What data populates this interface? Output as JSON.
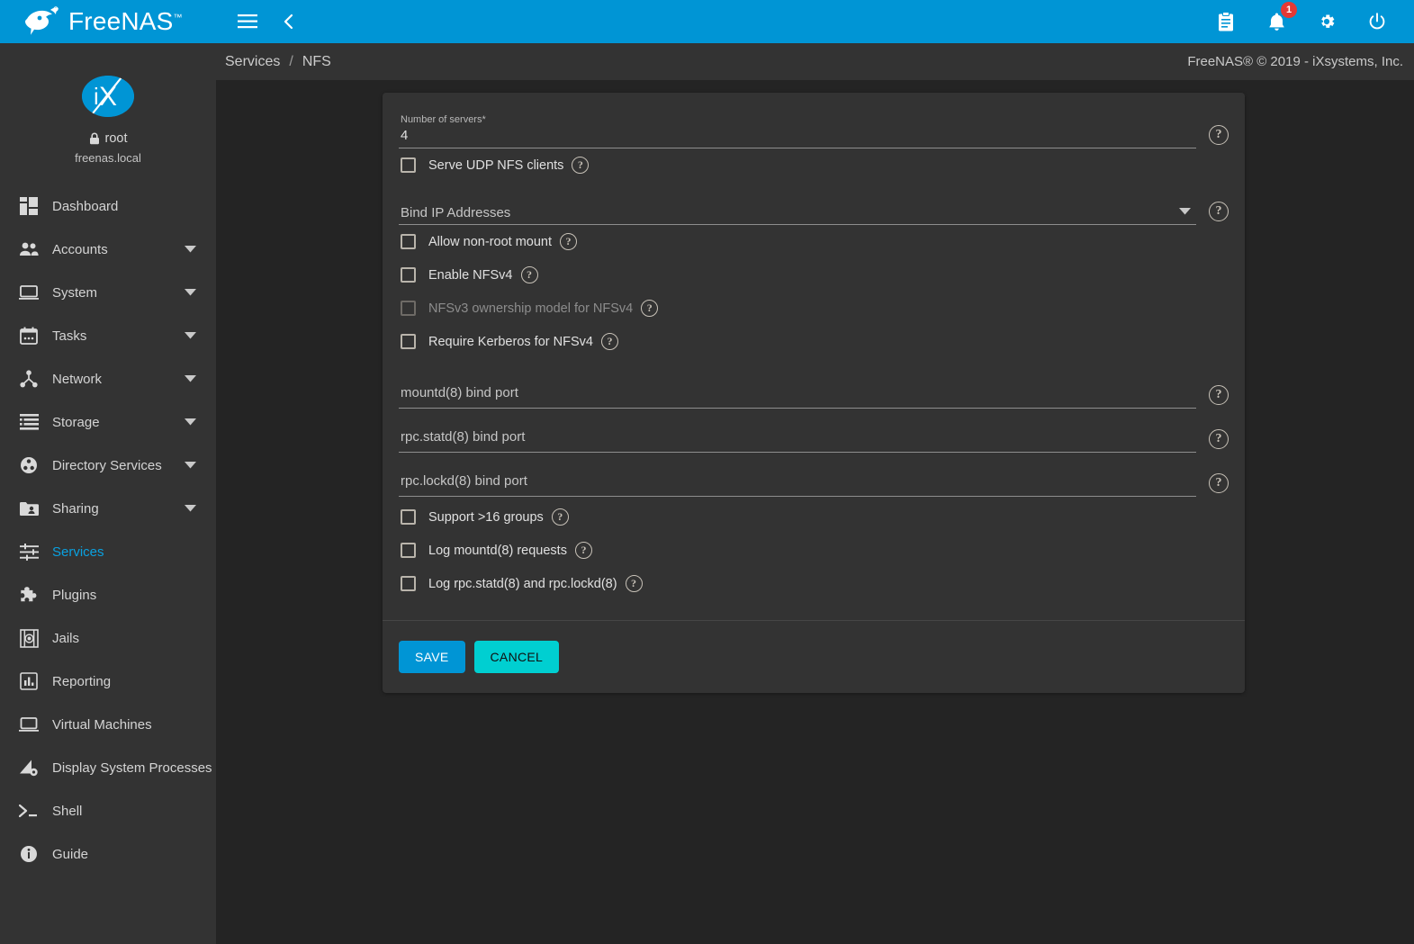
{
  "topbar": {
    "brand": "FreeNAS",
    "brand_tm": "™",
    "menu_icon": "hamburger-icon",
    "back_icon": "chevron-left-icon",
    "right_icons": [
      {
        "name": "clipboard-icon",
        "label": "Tasks"
      },
      {
        "name": "notifications-bell-icon",
        "label": "Alerts",
        "badge": "1"
      },
      {
        "name": "gear-icon",
        "label": "Settings"
      },
      {
        "name": "power-icon",
        "label": "Power"
      }
    ],
    "accent_color": "#0095d5"
  },
  "sidebar": {
    "logo_alt": "iX",
    "user": "root",
    "host": "freenas.local",
    "lock_icon": "lock-icon",
    "items": [
      {
        "label": "Dashboard",
        "icon": "dashboard-icon",
        "expandable": false,
        "active": false
      },
      {
        "label": "Accounts",
        "icon": "accounts-people-icon",
        "expandable": true,
        "active": false
      },
      {
        "label": "System",
        "icon": "system-monitor-icon",
        "expandable": true,
        "active": false
      },
      {
        "label": "Tasks",
        "icon": "calendar-tasks-icon",
        "expandable": true,
        "active": false
      },
      {
        "label": "Network",
        "icon": "network-node-icon",
        "expandable": true,
        "active": false
      },
      {
        "label": "Storage",
        "icon": "storage-list-icon",
        "expandable": true,
        "active": false
      },
      {
        "label": "Directory Services",
        "icon": "directory-services-icon",
        "expandable": true,
        "active": false
      },
      {
        "label": "Sharing",
        "icon": "sharing-folder-icon",
        "expandable": true,
        "active": false
      },
      {
        "label": "Services",
        "icon": "services-sliders-icon",
        "expandable": false,
        "active": true
      },
      {
        "label": "Plugins",
        "icon": "puzzle-piece-icon",
        "expandable": false,
        "active": false
      },
      {
        "label": "Jails",
        "icon": "jails-icon",
        "expandable": false,
        "active": false
      },
      {
        "label": "Reporting",
        "icon": "reporting-chart-icon",
        "expandable": false,
        "active": false
      },
      {
        "label": "Virtual Machines",
        "icon": "virtual-machines-icon",
        "expandable": false,
        "active": false
      },
      {
        "label": "Display System Processes",
        "icon": "system-processes-icon",
        "expandable": false,
        "active": false
      },
      {
        "label": "Shell",
        "icon": "shell-prompt-icon",
        "expandable": false,
        "active": false
      },
      {
        "label": "Guide",
        "icon": "info-circle-icon",
        "expandable": false,
        "active": false
      }
    ],
    "active_color": "#0aa1e0"
  },
  "breadcrumb": {
    "parent": "Services",
    "separator": "/",
    "current": "NFS",
    "copyright": "FreeNAS® © 2019 - iXsystems, Inc."
  },
  "form": {
    "number_of_servers": {
      "label": "Number of servers",
      "required_marker": "*",
      "value": "4",
      "help": "?"
    },
    "serve_udp": {
      "label": "Serve UDP NFS clients",
      "checked": false,
      "disabled": false,
      "help": "?"
    },
    "bind_ip": {
      "placeholder": "Bind IP Addresses",
      "value": "",
      "caret": "▼",
      "help": "?"
    },
    "allow_nonroot": {
      "label": "Allow non-root mount",
      "checked": false,
      "disabled": false,
      "help": "?"
    },
    "enable_nfsv4": {
      "label": "Enable NFSv4",
      "checked": false,
      "disabled": false,
      "help": "?"
    },
    "nfsv3_ownership": {
      "label": "NFSv3 ownership model for NFSv4",
      "checked": false,
      "disabled": true,
      "help": "?"
    },
    "require_kerberos": {
      "label": "Require Kerberos for NFSv4",
      "checked": false,
      "disabled": false,
      "help": "?"
    },
    "mountd_port": {
      "placeholder": "mountd(8) bind port",
      "value": "",
      "help": "?"
    },
    "statd_port": {
      "placeholder": "rpc.statd(8) bind port",
      "value": "",
      "help": "?"
    },
    "lockd_port": {
      "placeholder": "rpc.lockd(8) bind port",
      "value": "",
      "help": "?"
    },
    "support_16_groups": {
      "label": "Support >16 groups",
      "checked": false,
      "disabled": false,
      "help": "?"
    },
    "log_mountd": {
      "label": "Log mountd(8) requests",
      "checked": false,
      "disabled": false,
      "help": "?"
    },
    "log_statd_lockd": {
      "label": "Log rpc.statd(8) and rpc.lockd(8)",
      "checked": false,
      "disabled": false,
      "help": "?"
    },
    "save_label": "SAVE",
    "cancel_label": "CANCEL",
    "save_color": "#0095d5",
    "cancel_color": "#00cfd1"
  }
}
